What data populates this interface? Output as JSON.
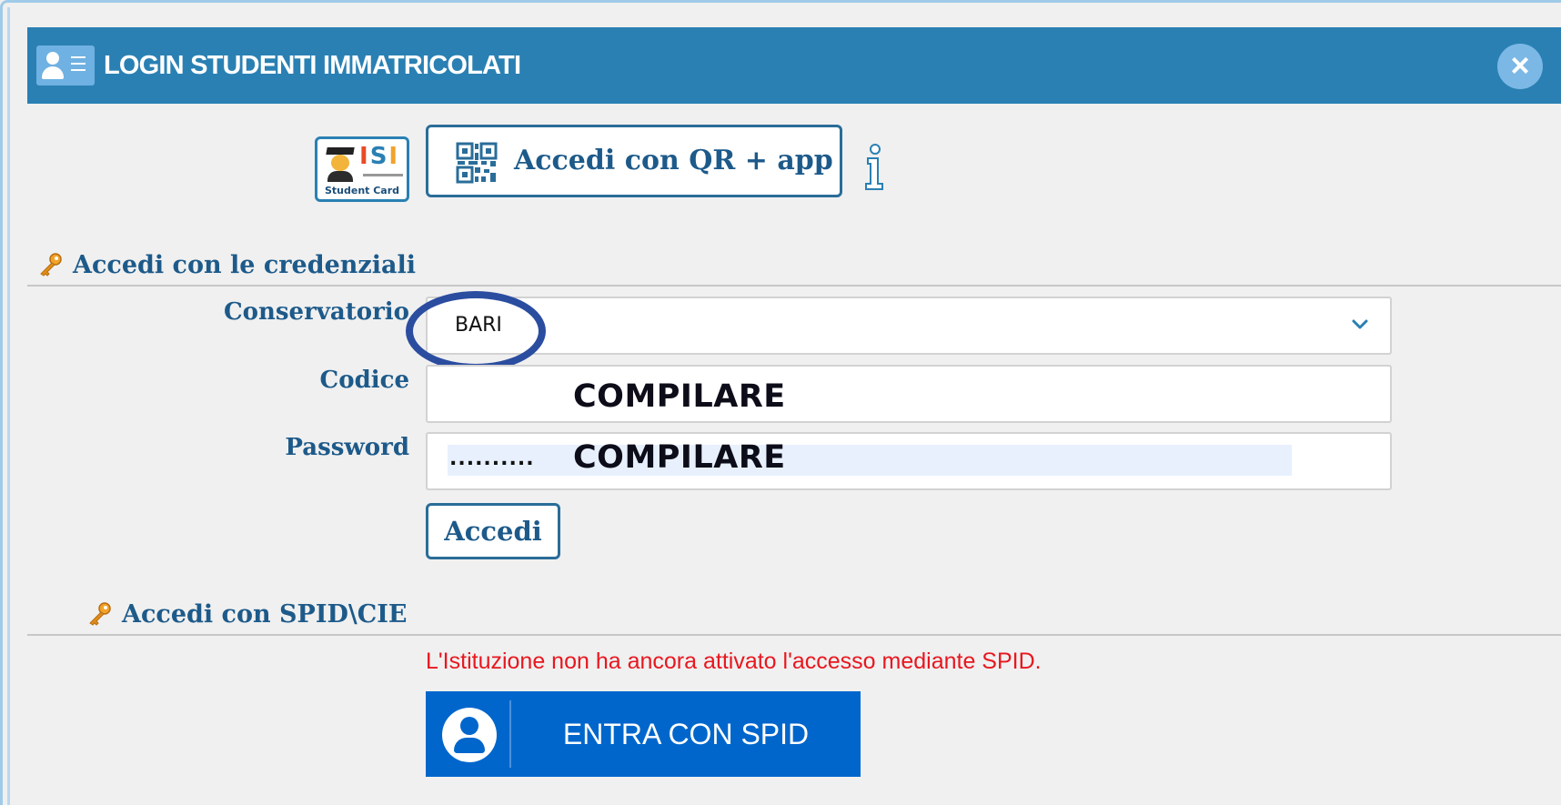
{
  "dialog": {
    "title": "LOGIN STUDENTI IMMATRICOLATI",
    "close_label": "×"
  },
  "quick_access": {
    "isi_card": {
      "brand": "ISI",
      "caption": "Student Card"
    },
    "qr_button_label": "Accedi con QR + app"
  },
  "credentials": {
    "section_title": "Accedi con le credenziali",
    "conservatorio_label": "Conservatorio",
    "conservatorio_value": "BARI",
    "codice_label": "Codice",
    "codice_overlay": "COMPILARE",
    "password_label": "Password",
    "password_mask": "..........",
    "password_overlay": "COMPILARE",
    "submit_label": "Accedi"
  },
  "spid": {
    "section_title": "Accedi con SPID\\CIE",
    "notice": "L'Istituzione non ha ancora attivato l'accesso mediante SPID.",
    "button_label": "ENTRA CON SPID"
  },
  "colors": {
    "titlebar": "#2a80b3",
    "label_text": "#1d5a8a",
    "spid_blue": "#0066cc",
    "notice_red": "#e8171f",
    "highlight_ring": "#2b4da0"
  }
}
